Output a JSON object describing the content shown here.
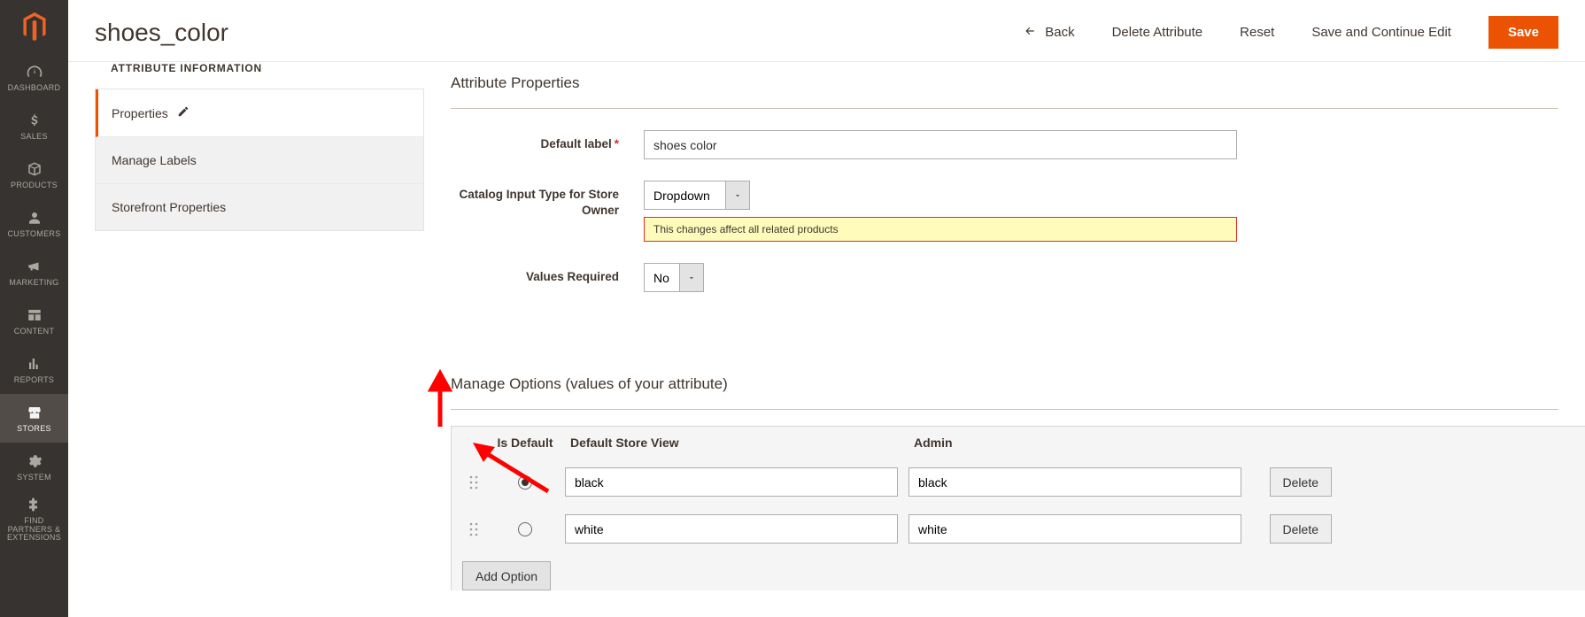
{
  "page_title": "shoes_color",
  "header_actions": {
    "back": "Back",
    "delete": "Delete Attribute",
    "reset": "Reset",
    "save_continue": "Save and Continue Edit",
    "save": "Save"
  },
  "nav": {
    "dashboard": "DASHBOARD",
    "sales": "SALES",
    "products": "PRODUCTS",
    "customers": "CUSTOMERS",
    "marketing": "MARKETING",
    "content": "CONTENT",
    "reports": "REPORTS",
    "stores": "STORES",
    "system": "SYSTEM",
    "find": "FIND PARTNERS & EXTENSIONS"
  },
  "side_tabs": {
    "title": "ATTRIBUTE INFORMATION",
    "properties": "Properties",
    "manage_labels": "Manage Labels",
    "storefront": "Storefront Properties"
  },
  "fieldsets": {
    "attribute_props": "Attribute Properties",
    "manage_options": "Manage Options (values of your attribute)"
  },
  "fields": {
    "default_label": {
      "label": "Default label",
      "value": "shoes color"
    },
    "input_type": {
      "label": "Catalog Input Type for Store Owner",
      "value": "Dropdown",
      "note": "This changes affect all related products"
    },
    "values_required": {
      "label": "Values Required",
      "value": "No"
    }
  },
  "options_table": {
    "headers": {
      "is_default": "Is Default",
      "store_view": "Default Store View",
      "admin": "Admin"
    },
    "rows": [
      {
        "default": true,
        "store_view": "black",
        "admin": "black"
      },
      {
        "default": false,
        "store_view": "white",
        "admin": "white"
      }
    ],
    "delete_label": "Delete",
    "add_label": "Add Option"
  }
}
